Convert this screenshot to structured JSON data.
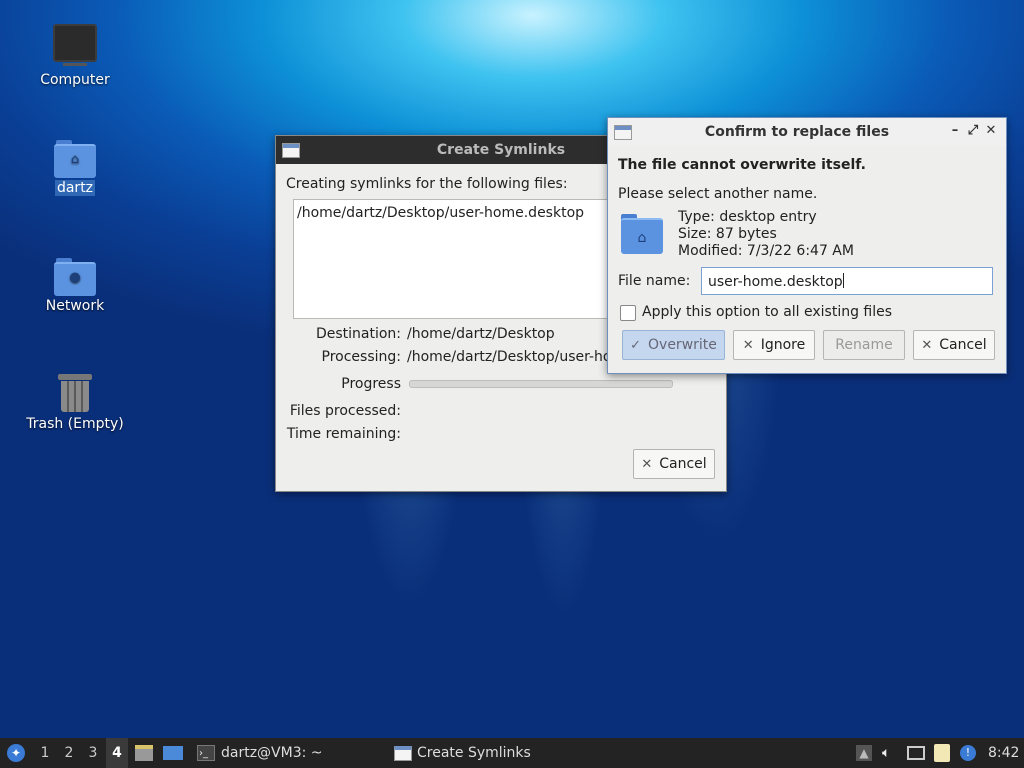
{
  "desktop": {
    "icons": [
      {
        "label": "Computer"
      },
      {
        "label": "dartz"
      },
      {
        "label": "Network"
      },
      {
        "label": "Trash (Empty)"
      }
    ]
  },
  "symlinks_window": {
    "title": "Create Symlinks",
    "heading": "Creating symlinks for the following files:",
    "files": [
      "/home/dartz/Desktop/user-home.desktop"
    ],
    "destination_label": "Destination:",
    "destination_value": "/home/dartz/Desktop",
    "processing_label": "Processing:",
    "processing_value": "/home/dartz/Desktop/user-home.desktop",
    "progress_label": "Progress",
    "progress_fraction": 0,
    "files_processed_label": "Files processed:",
    "time_remaining_label": "Time remaining:",
    "cancel_label": "Cancel"
  },
  "confirm_window": {
    "title": "Confirm to replace files",
    "error_heading": "The file cannot overwrite itself.",
    "instruction": "Please select another name.",
    "type_line": "Type: desktop entry",
    "size_line": "Size: 87 bytes",
    "modified_line": "Modified: 7/3/22 6:47 AM",
    "filename_label": "File name:",
    "filename_value": "user-home.desktop",
    "apply_all_label": "Apply this option to all existing files",
    "apply_all_checked": false,
    "buttons": {
      "overwrite": "Overwrite",
      "ignore": "Ignore",
      "rename": "Rename",
      "cancel": "Cancel"
    }
  },
  "taskbar": {
    "workspaces": [
      "1",
      "2",
      "3",
      "4"
    ],
    "current_workspace": "4",
    "tasks": [
      {
        "label": "dartz@VM3: ~",
        "icon": "terminal-icon"
      },
      {
        "label": "Create Symlinks",
        "icon": "window-icon"
      }
    ],
    "clock": "8:42"
  }
}
